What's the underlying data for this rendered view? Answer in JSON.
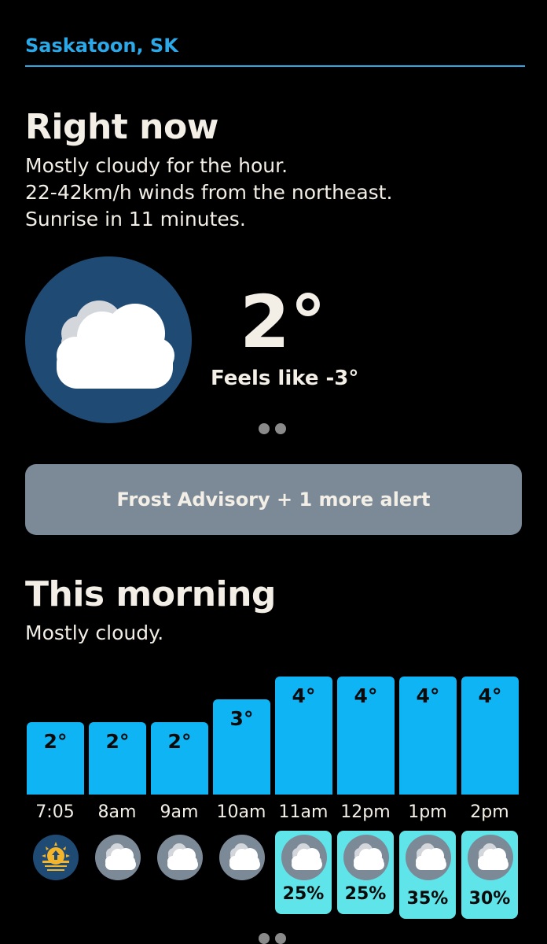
{
  "location": "Saskatoon, SK",
  "right_now": {
    "heading": "Right now",
    "lines": [
      "Mostly cloudy for the hour.",
      "22-42km/h winds from the northeast.",
      "Sunrise in 11 minutes."
    ],
    "icon": "cloud-icon",
    "temperature": "2°",
    "feels_like": "Feels like -3°"
  },
  "alert": {
    "label": "Frost Advisory + 1 more alert"
  },
  "this_morning": {
    "heading": "This morning",
    "summary": "Mostly cloudy.",
    "hours": [
      {
        "time": "7:05",
        "temp": "2°",
        "temp_value": 2,
        "icon": "sunrise-icon",
        "precip": ""
      },
      {
        "time": "8am",
        "temp": "2°",
        "temp_value": 2,
        "icon": "cloud-icon",
        "precip": ""
      },
      {
        "time": "9am",
        "temp": "2°",
        "temp_value": 2,
        "icon": "cloud-icon",
        "precip": ""
      },
      {
        "time": "10am",
        "temp": "3°",
        "temp_value": 3,
        "icon": "cloud-icon",
        "precip": ""
      },
      {
        "time": "11am",
        "temp": "4°",
        "temp_value": 4,
        "icon": "cloud-icon",
        "precip": "25%"
      },
      {
        "time": "12pm",
        "temp": "4°",
        "temp_value": 4,
        "icon": "cloud-icon",
        "precip": "25%"
      },
      {
        "time": "1pm",
        "temp": "4°",
        "temp_value": 4,
        "icon": "cloud-icon",
        "precip": "35%"
      },
      {
        "time": "2pm",
        "temp": "4°",
        "temp_value": 4,
        "icon": "cloud-icon",
        "precip": "30%"
      }
    ]
  },
  "colors": {
    "accent": "#2aa8e8",
    "bar": "#0fb4f5",
    "precip_card": "#5fe4ea",
    "alert_bg": "#7c8a98",
    "icon_circle": "#1f4a74",
    "text": "#f3efe6"
  }
}
